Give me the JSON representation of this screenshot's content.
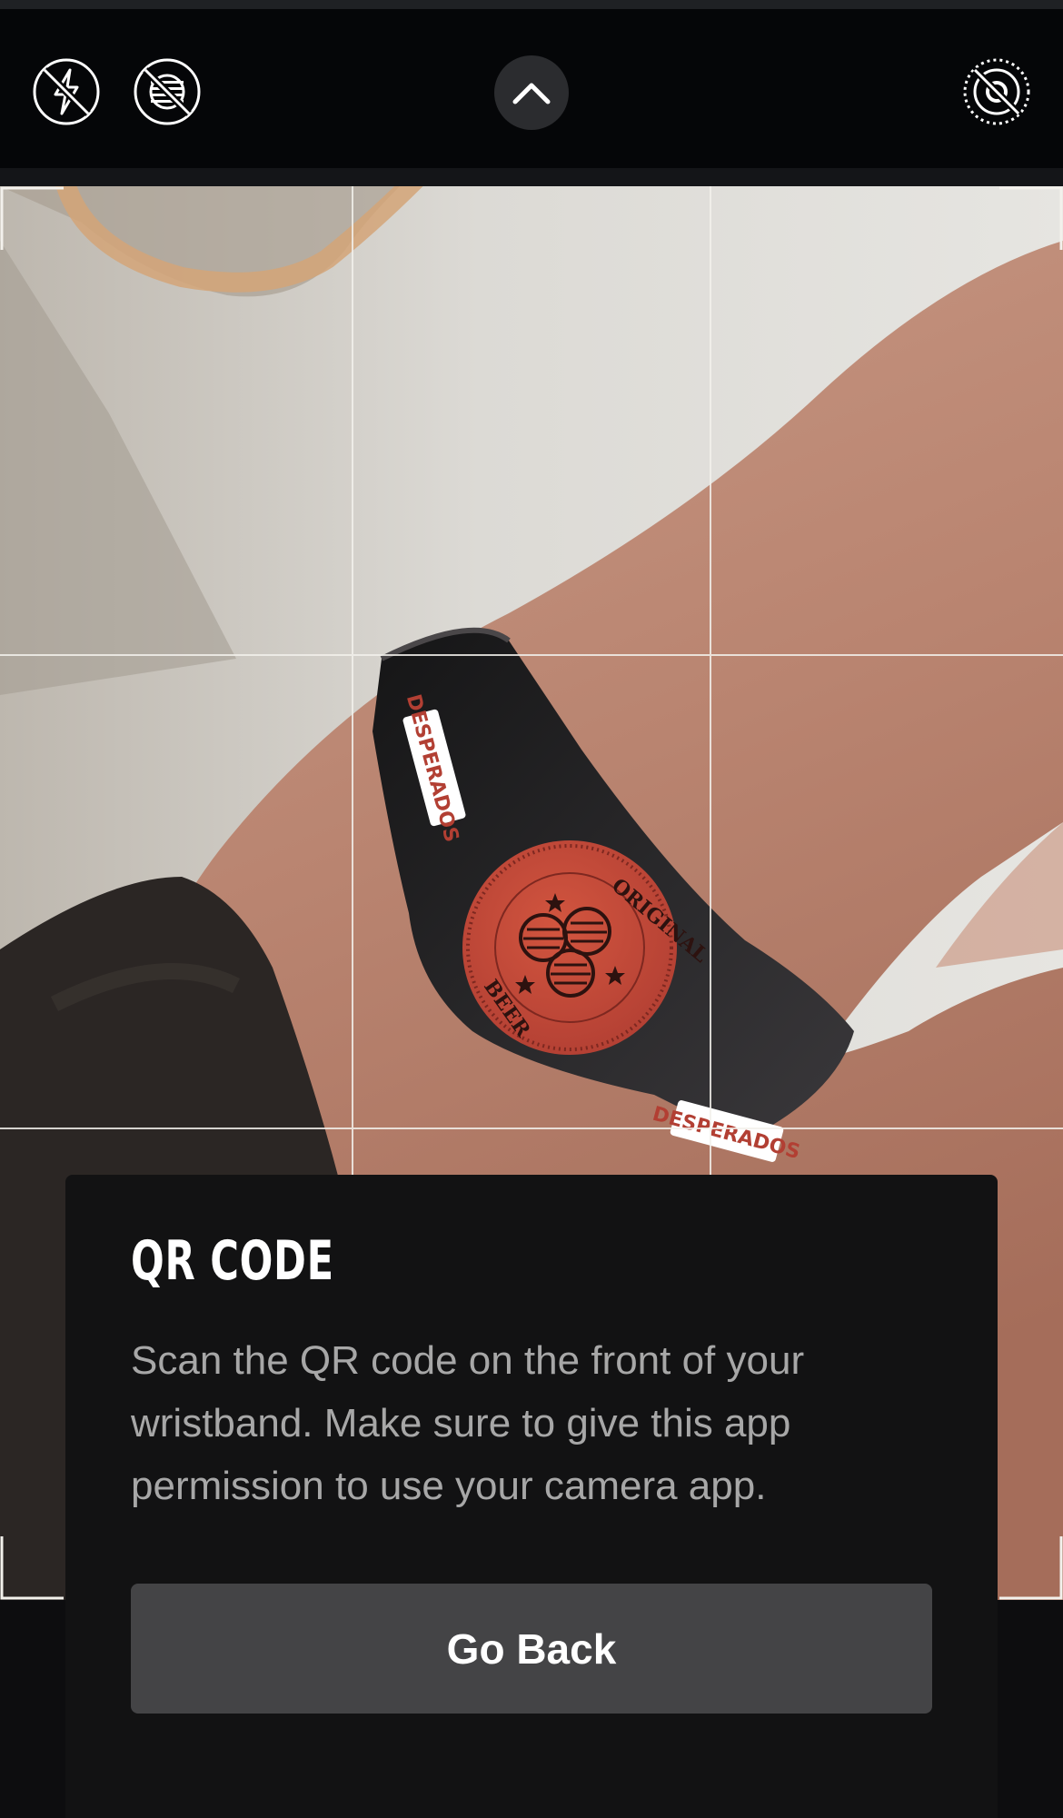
{
  "camera_toolbar": {
    "icons": {
      "flash_off": "flash-off-icon",
      "live_off": "live-photo-off-icon",
      "expand_controls": "chevron-up-icon",
      "macro_off": "macro-off-icon"
    },
    "colors": {
      "toolbar_bg": "#050608",
      "icon": "#ffffff",
      "chevron_bg": "#2b2c2f"
    }
  },
  "viewfinder": {
    "grid_lines": "on",
    "wristband_logo_text": "DESPERADOS",
    "wristband_badge_text": [
      "ORIGINAL",
      "BEER"
    ],
    "colors": {
      "band": "#232224",
      "badge": "#c4493a",
      "grid": "#f3f1ec"
    }
  },
  "instructions_panel": {
    "title": "QR CODE",
    "body": "Scan the QR code on the front of your wristband. Make sure to give this app permission to use your camera app.",
    "primary_button_label": "Go Back",
    "colors": {
      "panel_bg": "#121213",
      "title": "#ffffff",
      "body": "#a7a7a7",
      "button_bg": "#444446",
      "button_text": "#ffffff"
    }
  }
}
